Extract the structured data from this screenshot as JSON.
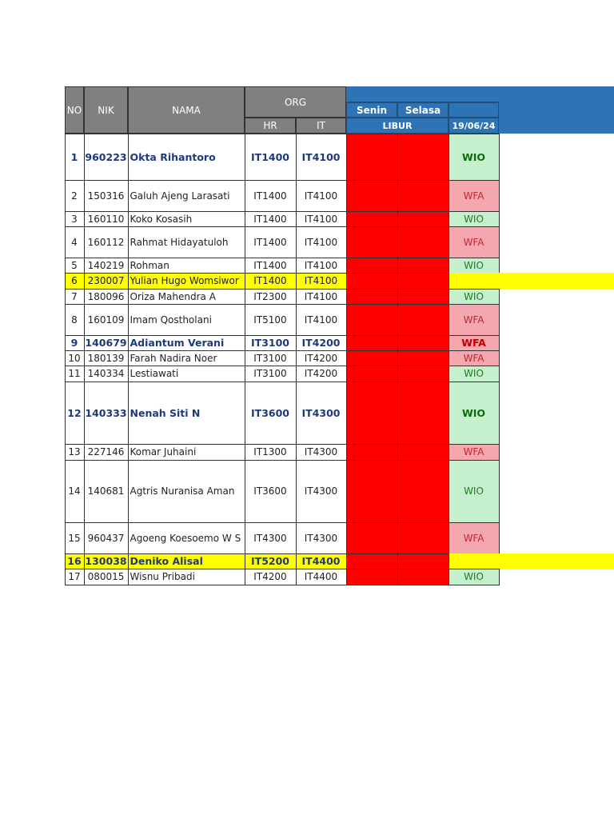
{
  "header": {
    "no": "NO",
    "nik": "NIK",
    "nama": "NAMA",
    "org": "ORG",
    "hr": "HR",
    "it": "IT",
    "senin": "Senin",
    "selasa": "Selasa",
    "libur": "LIBUR",
    "date": "19/06/24"
  },
  "colors": {
    "header_grey": "#808080",
    "header_blue": "#2e74b5",
    "libur_red": "#ff0000",
    "wio_green": "#c6efce",
    "wfa_pink": "#f4a7ae",
    "highlight_yellow": "#ffff00"
  },
  "rows": [
    {
      "no": "1",
      "nik": "960223",
      "nama": "Okta Rihantoro",
      "hr": "IT1400",
      "it": "IT4100",
      "status": "WIO",
      "bold": true
    },
    {
      "no": "2",
      "nik": "150316",
      "nama": "Galuh Ajeng Larasati",
      "hr": "IT1400",
      "it": "IT4100",
      "status": "WFA"
    },
    {
      "no": "3",
      "nik": "160110",
      "nama": "Koko Kosasih",
      "hr": "IT1400",
      "it": "IT4100",
      "status": "WIO"
    },
    {
      "no": "4",
      "nik": "160112",
      "nama": "Rahmat Hidayatuloh",
      "hr": "IT1400",
      "it": "IT4100",
      "status": "WFA"
    },
    {
      "no": "5",
      "nik": "140219",
      "nama": "Rohman",
      "hr": "IT1400",
      "it": "IT4100",
      "status": "WIO"
    },
    {
      "no": "6",
      "nik": "230007",
      "nama": "Yulian Hugo Womsiwor",
      "hr": "IT1400",
      "it": "IT4100",
      "status": "",
      "highlight": true
    },
    {
      "no": "7",
      "nik": "180096",
      "nama": "Oriza Mahendra A",
      "hr": "IT2300",
      "it": "IT4100",
      "status": "WIO"
    },
    {
      "no": "8",
      "nik": "160109",
      "nama": "Imam Qostholani",
      "hr": "IT5100",
      "it": "IT4100",
      "status": "WFA"
    },
    {
      "no": "9",
      "nik": "140679",
      "nama": "Adiantum Verani",
      "hr": "IT3100",
      "it": "IT4200",
      "status": "WFA",
      "bold": true
    },
    {
      "no": "10",
      "nik": "180139",
      "nama": "Farah Nadira Noer",
      "hr": "IT3100",
      "it": "IT4200",
      "status": "WFA"
    },
    {
      "no": "11",
      "nik": "140334",
      "nama": "Lestiawati",
      "hr": "IT3100",
      "it": "IT4200",
      "status": "WIO"
    },
    {
      "no": "12",
      "nik": "140333",
      "nama": "Nenah Siti N",
      "hr": "IT3600",
      "it": "IT4300",
      "status": "WIO",
      "bold": true
    },
    {
      "no": "13",
      "nik": "227146",
      "nama": "Komar Juhaini",
      "hr": "IT1300",
      "it": "IT4300",
      "status": "WFA"
    },
    {
      "no": "14",
      "nik": "140681",
      "nama": "Agtris Nuranisa Aman",
      "hr": "IT3600",
      "it": "IT4300",
      "status": "WIO"
    },
    {
      "no": "15",
      "nik": "960437",
      "nama": "Agoeng Koesoemo W S",
      "hr": "IT4300",
      "it": "IT4300",
      "status": "WFA"
    },
    {
      "no": "16",
      "nik": "130038",
      "nama": "Deniko Alisal",
      "hr": "IT5200",
      "it": "IT4400",
      "status": "",
      "bold": true,
      "highlight": true
    },
    {
      "no": "17",
      "nik": "080015",
      "nama": "Wisnu Pribadi",
      "hr": "IT4200",
      "it": "IT4400",
      "status": "WIO"
    }
  ]
}
